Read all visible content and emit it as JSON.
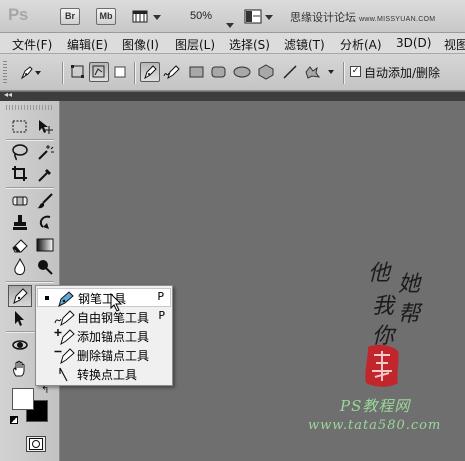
{
  "app": {
    "logo": "Ps",
    "bridge_button": "Br",
    "minibridge_button": "Mb",
    "zoom": "50%",
    "site_text": "思缘设计论坛",
    "site_small": "www.MISSYUAN.COM"
  },
  "menu": {
    "items": [
      "文件(F)",
      "编辑(E)",
      "图像(I)",
      "图层(L)",
      "选择(S)",
      "滤镜(T)",
      "分析(A)",
      "3D(D)",
      "视图"
    ]
  },
  "options": {
    "auto_add_delete_label": "自动添加/删除",
    "auto_add_delete_checked": "✓"
  },
  "toolbox": {
    "swap_glyph": "↰",
    "mini_default": ""
  },
  "flyout": {
    "items": [
      {
        "label": "钢笔工具",
        "key": "P",
        "icon": "pen-icon",
        "active": true
      },
      {
        "label": "自由钢笔工具",
        "key": "P",
        "icon": "freeform-pen-icon",
        "active": false
      },
      {
        "label": "添加锚点工具",
        "key": "",
        "icon": "add-anchor-icon",
        "active": false
      },
      {
        "label": "删除锚点工具",
        "key": "",
        "icon": "delete-anchor-icon",
        "active": false
      },
      {
        "label": "转换点工具",
        "key": "",
        "icon": "convert-point-icon",
        "active": false
      }
    ]
  },
  "watermark": {
    "chars": [
      "他",
      "她",
      "我",
      "帮",
      "你"
    ],
    "name_cn": "PS教程网",
    "url": "www.tata580.com"
  },
  "colors": {
    "canvas": "#6f6f6f",
    "watermark_green": "#9ad69a",
    "seal_red": "#c0262c"
  }
}
